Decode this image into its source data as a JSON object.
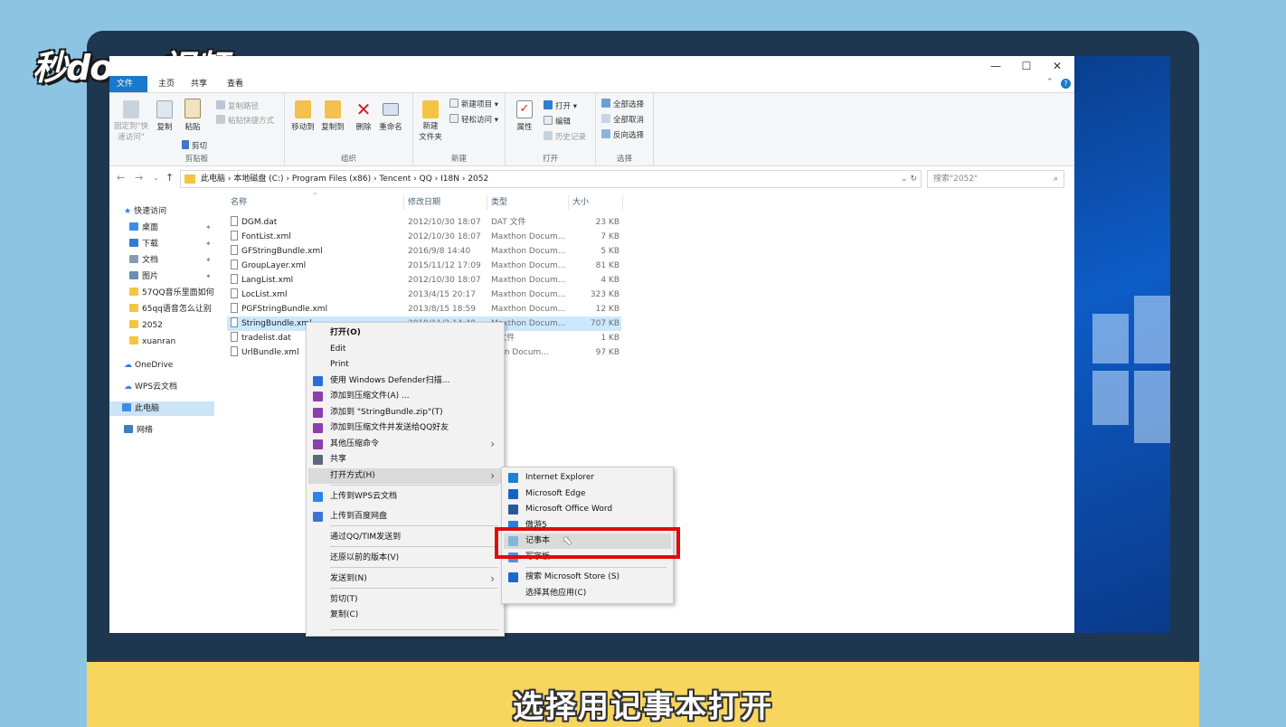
{
  "logo": "秒dong视频",
  "caption": "选择用记事本打开",
  "window": {
    "controls": [
      "—",
      "☐",
      "✕"
    ],
    "tabs": [
      "文件",
      "主页",
      "共享",
      "查看"
    ]
  },
  "ribbon": {
    "pin": "固定到\"快速访问\"",
    "copy": "复制",
    "paste": "粘贴",
    "copy_path": "复制路径",
    "paste_shortcut": "粘贴快捷方式",
    "cut": "剪切",
    "clipboard_group": "剪贴板",
    "move_to": "移动到",
    "copy_to": "复制到",
    "delete": "删除",
    "rename": "重命名",
    "organize_group": "组织",
    "new_folder": "新建\n文件夹",
    "new_item": "新建项目 ▾",
    "easy_access": "轻松访问 ▾",
    "new_group": "新建",
    "properties": "属性",
    "open": "打开 ▾",
    "edit": "编辑",
    "history": "历史记录",
    "open_group": "打开",
    "select_all": "全部选择",
    "select_none": "全部取消",
    "invert_select": "反向选择",
    "select_group": "选择"
  },
  "address": {
    "path": "此电脑  ›  本地磁盘 (C:)  ›  Program Files (x86)  ›  Tencent  ›  QQ  ›  I18N  ›  2052",
    "search_placeholder": "搜索\"2052\""
  },
  "nav": {
    "quick_access": "快速访问",
    "items": [
      {
        "label": "桌面",
        "color": "#3a8ee6"
      },
      {
        "label": "下载",
        "color": "#2f7fd1"
      },
      {
        "label": "文档",
        "color": "#8a9bb0"
      },
      {
        "label": "图片",
        "color": "#6c8fb3"
      },
      {
        "label": "57QQ音乐里面如何",
        "color": "#f4c542"
      },
      {
        "label": "65qq语音怎么让别",
        "color": "#f4c542"
      },
      {
        "label": "2052",
        "color": "#f4c542"
      },
      {
        "label": "xuanran",
        "color": "#f4c542"
      }
    ],
    "onedrive": "OneDrive",
    "wps": "WPS云文档",
    "this_pc": "此电脑",
    "network": "网络"
  },
  "columns": {
    "name": "名称",
    "date": "修改日期",
    "type": "类型",
    "size": "大小"
  },
  "files": [
    {
      "name": "DGM.dat",
      "date": "2012/10/30 18:07",
      "type": "DAT 文件",
      "size": "23 KB"
    },
    {
      "name": "FontList.xml",
      "date": "2012/10/30 18:07",
      "type": "Maxthon Docum...",
      "size": "7 KB"
    },
    {
      "name": "GFStringBundle.xml",
      "date": "2016/9/8 14:40",
      "type": "Maxthon Docum...",
      "size": "5 KB"
    },
    {
      "name": "GroupLayer.xml",
      "date": "2015/11/12 17:09",
      "type": "Maxthon Docum...",
      "size": "81 KB"
    },
    {
      "name": "LangList.xml",
      "date": "2012/10/30 18:07",
      "type": "Maxthon Docum...",
      "size": "4 KB"
    },
    {
      "name": "LocList.xml",
      "date": "2013/4/15 20:17",
      "type": "Maxthon Docum...",
      "size": "323 KB"
    },
    {
      "name": "PGFStringBundle.xml",
      "date": "2013/8/15 18:59",
      "type": "Maxthon Docum...",
      "size": "12 KB"
    },
    {
      "name": "StringBundle.xml",
      "date": "2019/11/2 14:40",
      "type": "Maxthon Docum...",
      "size": "707 KB"
    },
    {
      "name": "tradelist.dat",
      "date": "",
      "type": "T 文件",
      "size": "1 KB"
    },
    {
      "name": "UrlBundle.xml",
      "date": "",
      "type": "thon Docum...",
      "size": "97 KB"
    }
  ],
  "context_menu": [
    {
      "label": "打开(O)",
      "bold": true,
      "icon": ""
    },
    {
      "label": "Edit",
      "icon": ""
    },
    {
      "label": "Print",
      "icon": ""
    },
    {
      "label": "使用 Windows Defender扫描...",
      "icon": "#2a6fd6"
    },
    {
      "label": "添加到压缩文件(A) ...",
      "icon": "#8b3fa8"
    },
    {
      "label": "添加到 \"StringBundle.zip\"(T)",
      "icon": "#8b3fa8"
    },
    {
      "label": "添加到压缩文件并发送给QQ好友",
      "icon": "#8b3fa8"
    },
    {
      "label": "其他压缩命令",
      "icon": "#8b3fa8",
      "arrow": true
    },
    {
      "label": "共享",
      "icon": "#5a6a7a"
    },
    {
      "label": "打开方式(H)",
      "icon": "",
      "arrow": true,
      "hover": true
    },
    {
      "label": "上传到WPS云文档",
      "icon": "#2a86e8"
    },
    {
      "label": "上传到百度网盘",
      "icon": "#3b73d6"
    },
    {
      "label": "通过QQ/TIM发送到",
      "icon": ""
    },
    {
      "label": "还原以前的版本(V)",
      "icon": ""
    },
    {
      "label": "发送到(N)",
      "icon": "",
      "arrow": true
    },
    {
      "label": "剪切(T)",
      "icon": ""
    },
    {
      "label": "复制(C)",
      "icon": ""
    }
  ],
  "submenu": [
    {
      "label": "Internet Explorer",
      "icon": "#1e7fd8"
    },
    {
      "label": "Microsoft Edge",
      "icon": "#1565c0"
    },
    {
      "label": "Microsoft Office Word",
      "icon": "#2b5797"
    },
    {
      "label": "傲游5",
      "icon": "#2a7de1"
    },
    {
      "label": "记事本",
      "icon": "#7fb6d9"
    },
    {
      "label": "写字板",
      "icon": "#5b8fd6"
    },
    {
      "label": "搜索 Microsoft Store (S)",
      "icon": "#1b6ac9"
    },
    {
      "label": "选择其他应用(C)",
      "icon": ""
    }
  ],
  "colors": {
    "accent": "#1979ca",
    "highlight_box": "#e00b0b",
    "caption_bg": "#f7d55f"
  }
}
